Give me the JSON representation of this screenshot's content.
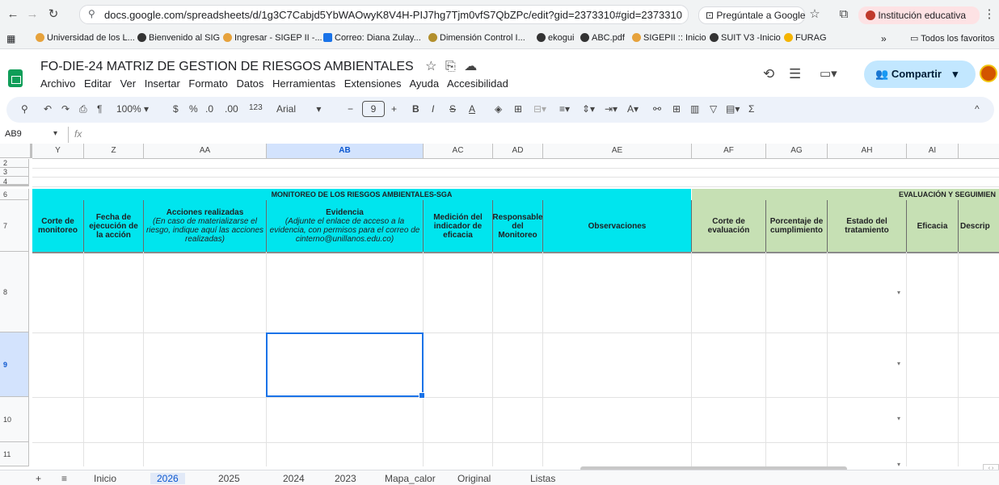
{
  "browser": {
    "url": "docs.google.com/spreadsheets/d/1g3C7Cabjd5YbWAOwyK8V4H-PIJ7hg7Tjm0vfS7QbZPc/edit?gid=2373310#gid=2373310",
    "ask_google": "Pregúntale a Google",
    "profile": "Institución educativa",
    "all_bookmarks": "Todos los favoritos",
    "bookmarks": [
      {
        "label": "Universidad de los L...",
        "color": "#e6a23c"
      },
      {
        "label": "Bienvenido al SIG",
        "color": "#333333"
      },
      {
        "label": "Ingresar - SIGEP II -...",
        "color": "#e6a23c"
      },
      {
        "label": "Correo: Diana Zulay...",
        "color": "#1a73e8"
      },
      {
        "label": "Dimensión Control I...",
        "color": "#b28f2d"
      },
      {
        "label": "ekogui",
        "color": "#333333"
      },
      {
        "label": "ABC.pdf",
        "color": "#333333"
      },
      {
        "label": "SIGEPII :: Inicio",
        "color": "#e6a23c"
      },
      {
        "label": "SUIT V3 -Inicio",
        "color": "#333333"
      },
      {
        "label": "FURAG",
        "color": "#f4b400"
      }
    ]
  },
  "doc": {
    "title": "FO-DIE-24 MATRIZ DE GESTION DE RIESGOS AMBIENTALES",
    "menu": [
      "Archivo",
      "Editar",
      "Ver",
      "Insertar",
      "Formato",
      "Datos",
      "Herramientas",
      "Extensiones",
      "Ayuda",
      "Accesibilidad"
    ],
    "share": "Compartir"
  },
  "toolbar": {
    "zoom": "100%",
    "currency": "$",
    "percent": "%",
    "dec_less": ".0",
    "dec_more": ".00",
    "format_num": "123",
    "font": "Arial",
    "font_size": "9"
  },
  "formula": {
    "cell_ref": "AB9",
    "fx": "fx"
  },
  "grid": {
    "columns": [
      "Y",
      "Z",
      "AA",
      "AB",
      "AC",
      "AD",
      "AE",
      "AF",
      "AG",
      "AH",
      "AI"
    ],
    "rows": [
      "2",
      "3",
      "4",
      "6",
      "7",
      "8",
      "9",
      "10",
      "11"
    ],
    "band_monitoring": "MONITOREO DE LOS RIESGOS AMBIENTALES-SGA",
    "band_evaluation": "EVALUACIÓN Y SEGUIMIEN",
    "headers": [
      {
        "title": "Corte de monitoreo",
        "note": ""
      },
      {
        "title": "Fecha de ejecución de la acción",
        "note": ""
      },
      {
        "title": "Acciones realizadas",
        "note": "(En caso de materializarse el riesgo, indique aquí las acciones realizadas)"
      },
      {
        "title": "Evidencia",
        "note": "(Adjunte el enlace de acceso a la evidencia, con permisos para el correo de cinterno@unillanos.edu.co)"
      },
      {
        "title": "Medición del indicador de eficacia",
        "note": ""
      },
      {
        "title": "Responsable del Monitoreo",
        "note": ""
      },
      {
        "title": "Observaciones",
        "note": ""
      },
      {
        "title": "Corte de evaluación",
        "note": ""
      },
      {
        "title": "Porcentaje de cumplimiento",
        "note": ""
      },
      {
        "title": "Estado del tratamiento",
        "note": ""
      },
      {
        "title": "Eficacia",
        "note": ""
      },
      {
        "title": "Descrip",
        "note": ""
      }
    ]
  },
  "tabs": [
    "Inicio",
    "2026",
    "2025",
    "2024",
    "2023",
    "Mapa_calor",
    "Original",
    "Listas"
  ],
  "colors": {
    "band_monitoring": "#00e5ee",
    "band_evaluation": "#c6e0b4",
    "header_cyan": "#00e5ee",
    "header_green": "#c6e0b4",
    "selection": "#1a73e8"
  }
}
